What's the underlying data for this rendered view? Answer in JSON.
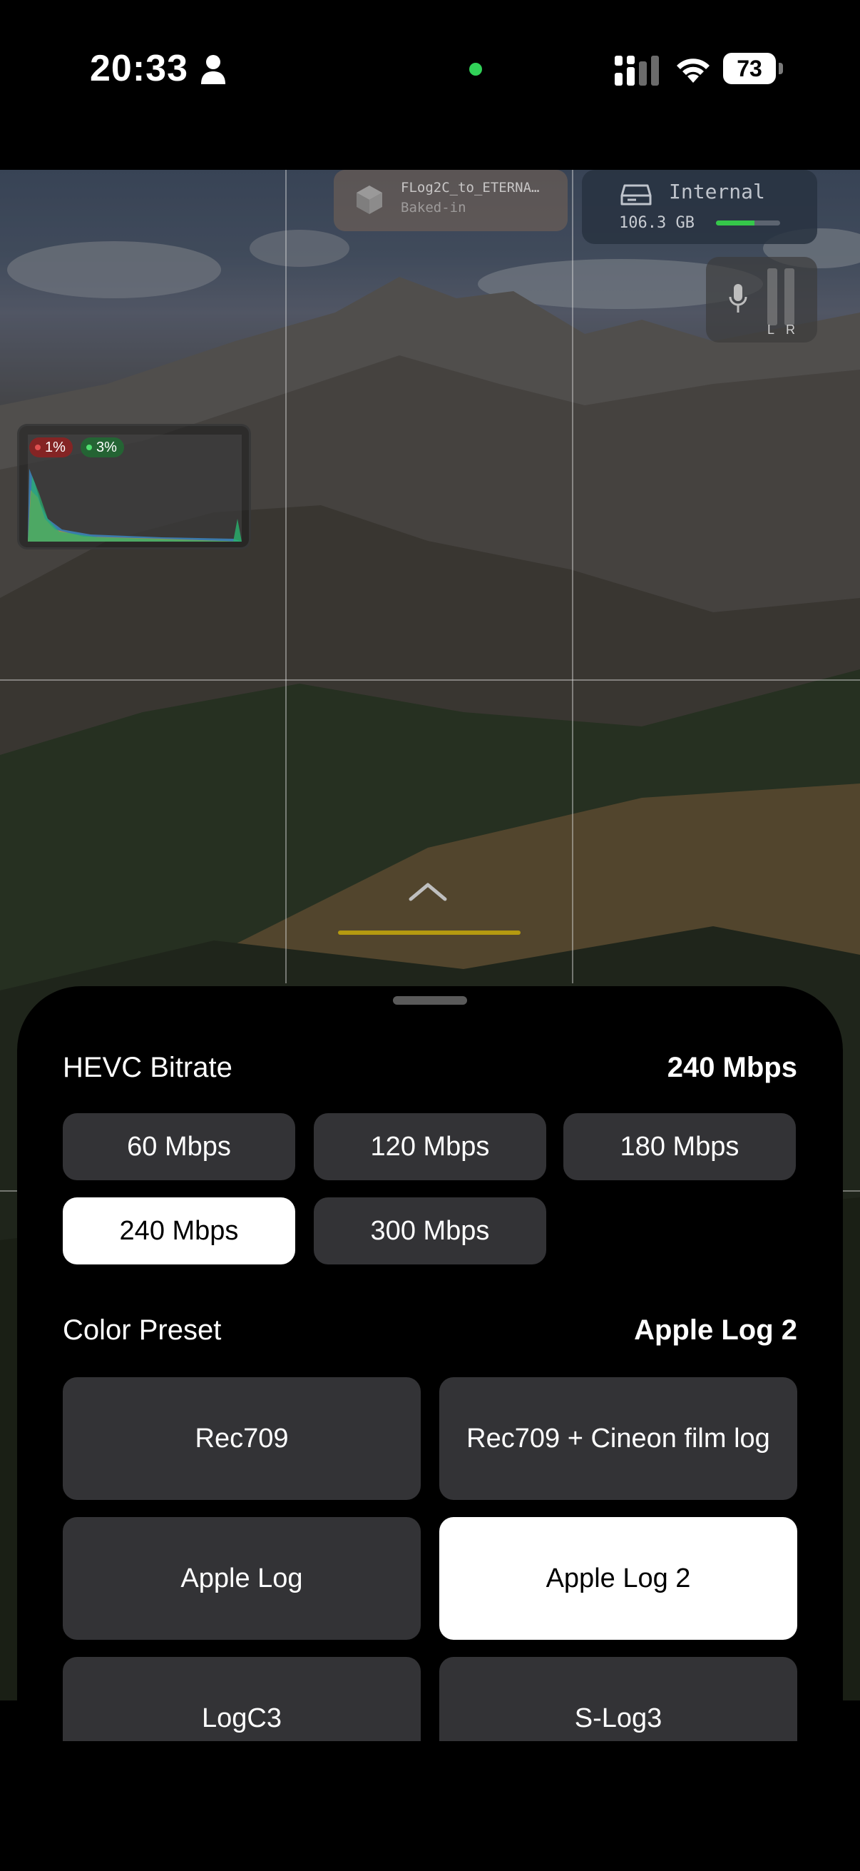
{
  "status_bar": {
    "time": "20:33",
    "battery_level": "73",
    "icons": [
      "person-icon",
      "signal-icon",
      "wifi-icon",
      "battery-icon"
    ],
    "privacy_indicator_color": "#31d158"
  },
  "viewfinder": {
    "lut": {
      "name": "FLog2C_to_ETERNA…",
      "mode": "Baked-in",
      "icon": "cube-icon"
    },
    "storage": {
      "name": "Internal",
      "free": "106.3 GB",
      "fill_fraction": 0.6,
      "icon": "drive-icon"
    },
    "audio": {
      "left_label": "L",
      "right_label": "R",
      "icon": "mic-icon"
    },
    "histogram": {
      "clip_low": "1%",
      "clip_high": "3%"
    },
    "expand_icon": "chevron-up-icon"
  },
  "sheet": {
    "bitrate": {
      "title": "HEVC Bitrate",
      "current": "240 Mbps",
      "options": [
        {
          "label": "60 Mbps",
          "selected": false
        },
        {
          "label": "120 Mbps",
          "selected": false
        },
        {
          "label": "180 Mbps",
          "selected": false
        },
        {
          "label": "240 Mbps",
          "selected": true
        },
        {
          "label": "300 Mbps",
          "selected": false
        }
      ]
    },
    "color_preset": {
      "title": "Color Preset",
      "current": "Apple Log 2",
      "options": [
        {
          "label": "Rec709",
          "selected": false
        },
        {
          "label": "Rec709 + Cineon film log",
          "selected": false
        },
        {
          "label": "Apple Log",
          "selected": false
        },
        {
          "label": "Apple Log 2",
          "selected": true
        },
        {
          "label": "LogC3",
          "selected": false
        },
        {
          "label": "S-Log3",
          "selected": false
        }
      ]
    }
  },
  "colors": {
    "accent_selected": "#ffffff",
    "option_bg": "#333336",
    "storage_bar": "#35c74a",
    "zoom_indicator": "#b59a10"
  }
}
